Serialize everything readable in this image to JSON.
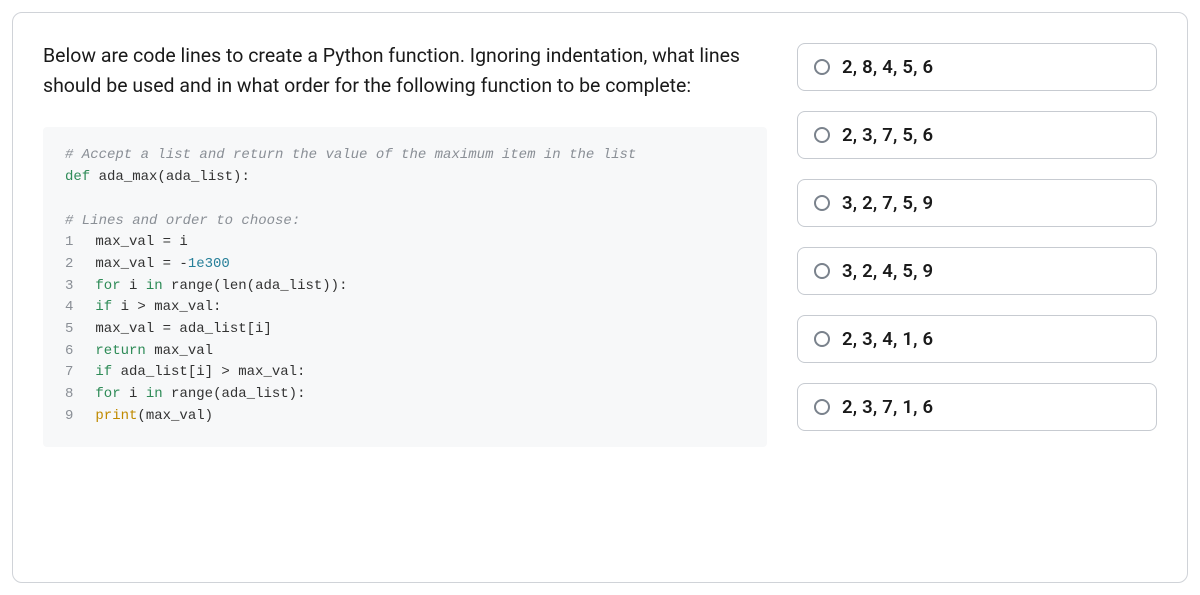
{
  "question": "Below are code lines to create a Python function. Ignoring indentation, what lines should be used and in what order for the following function to be complete:",
  "code": {
    "comment_top": "# Accept a list and return the value of the maximum item in the list",
    "def_kw": "def",
    "def_rest": " ada_max(ada_list):",
    "comment_choose": "# Lines and order to choose:",
    "lines": [
      {
        "n": "1",
        "text_a": "max_val = i"
      },
      {
        "n": "2",
        "text_a": "max_val = -",
        "num": "1e300"
      },
      {
        "n": "3",
        "kw": "for",
        "text_a": " i ",
        "kw2": "in",
        "text_b": " range(len(ada_list)):"
      },
      {
        "n": "4",
        "kw": "if",
        "text_a": " i > max_val:"
      },
      {
        "n": "5",
        "text_a": "max_val = ada_list[i]"
      },
      {
        "n": "6",
        "kw": "return",
        "text_a": " max_val"
      },
      {
        "n": "7",
        "kw": "if",
        "text_a": " ada_list[i] > max_val:"
      },
      {
        "n": "8",
        "kw": "for",
        "text_a": " i ",
        "kw2": "in",
        "text_b": " range(ada_list):"
      },
      {
        "n": "9",
        "fn": "print",
        "text_a": "(max_val)"
      }
    ]
  },
  "options": [
    "2, 8, 4, 5, 6",
    "2, 3, 7, 5, 6",
    "3, 2, 7, 5, 9",
    "3, 2, 4, 5, 9",
    "2, 3, 4, 1, 6",
    "2, 3, 7, 1, 6"
  ]
}
